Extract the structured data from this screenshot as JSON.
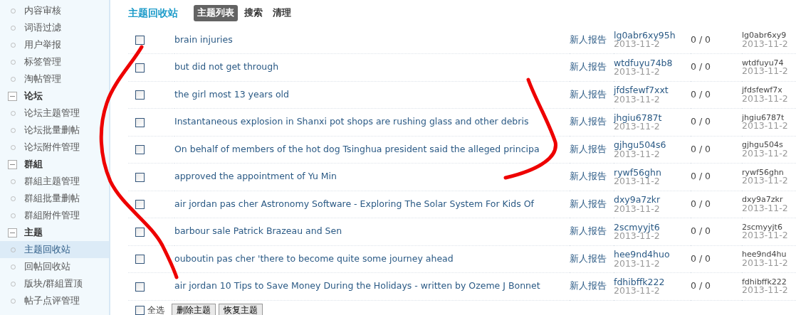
{
  "sidebar": {
    "sections": [
      {
        "items": [
          {
            "label": "内容审核",
            "selected": false
          },
          {
            "label": "词语过滤",
            "selected": false
          },
          {
            "label": "用户举报",
            "selected": false
          },
          {
            "label": "标签管理",
            "selected": false
          },
          {
            "label": "淘帖管理",
            "selected": false
          }
        ]
      },
      {
        "title": "论坛",
        "expanded": true,
        "items": [
          {
            "label": "论坛主题管理",
            "selected": false
          },
          {
            "label": "论坛批量删帖",
            "selected": false
          },
          {
            "label": "论坛附件管理",
            "selected": false
          }
        ]
      },
      {
        "title": "群組",
        "expanded": true,
        "items": [
          {
            "label": "群組主题管理",
            "selected": false
          },
          {
            "label": "群組批量删帖",
            "selected": false
          },
          {
            "label": "群組附件管理",
            "selected": false
          }
        ]
      },
      {
        "title": "主题",
        "expanded": true,
        "items": [
          {
            "label": "主题回收站",
            "selected": true
          },
          {
            "label": "回帖回收站",
            "selected": false
          },
          {
            "label": "版块/群組置顶",
            "selected": false
          },
          {
            "label": "帖子点评管理",
            "selected": false
          }
        ]
      }
    ]
  },
  "header": {
    "title": "主题回收站",
    "tabs": [
      {
        "label": "主题列表",
        "selected": true
      },
      {
        "label": "搜索",
        "selected": false
      },
      {
        "label": "清理",
        "selected": false
      }
    ]
  },
  "table": {
    "rows": [
      {
        "checked": false,
        "subject": "brain injuries",
        "forum": "新人报告",
        "author": "lg0abr6xy95h",
        "date": "2013-11-2",
        "replies": "0 / 0",
        "last_author": "lg0abr6xy9",
        "last_date": "2013-11-2"
      },
      {
        "checked": false,
        "subject": "but did not get through",
        "forum": "新人报告",
        "author": "wtdfuyu74b8",
        "date": "2013-11-2",
        "replies": "0 / 0",
        "last_author": "wtdfuyu74",
        "last_date": "2013-11-2"
      },
      {
        "checked": false,
        "subject": "the girl most 13 years old",
        "forum": "新人报告",
        "author": "jfdsfewf7xxt",
        "date": "2013-11-2",
        "replies": "0 / 0",
        "last_author": "jfdsfewf7x",
        "last_date": "2013-11-2"
      },
      {
        "checked": false,
        "subject": "Instantaneous explosion in Shanxi pot shops are rushing glass and other debris",
        "forum": "新人报告",
        "author": "jhgiu6787t",
        "date": "2013-11-2",
        "replies": "0 / 0",
        "last_author": "jhgiu6787t",
        "last_date": "2013-11-2"
      },
      {
        "checked": false,
        "subject": "On behalf of members of the hot dog Tsinghua president said the alleged principa",
        "forum": "新人报告",
        "author": "gjhgu504s6",
        "date": "2013-11-2",
        "replies": "0 / 0",
        "last_author": "gjhgu504s",
        "last_date": "2013-11-2"
      },
      {
        "checked": false,
        "subject": "approved the appointment of Yu Min",
        "forum": "新人报告",
        "author": "rywf56ghn",
        "date": "2013-11-2",
        "replies": "0 / 0",
        "last_author": "rywf56ghn",
        "last_date": "2013-11-2"
      },
      {
        "checked": false,
        "subject": "air jordan pas cher Astronomy Software - Exploring The Solar System For Kids Of",
        "forum": "新人报告",
        "author": "dxy9a7zkr",
        "date": "2013-11-2",
        "replies": "0 / 0",
        "last_author": "dxy9a7zkr",
        "last_date": "2013-11-2"
      },
      {
        "checked": false,
        "subject": "barbour sale Patrick Brazeau and Sen",
        "forum": "新人报告",
        "author": "2scmyyjt6",
        "date": "2013-11-2",
        "replies": "0 / 0",
        "last_author": "2scmyyjt6",
        "last_date": "2013-11-2"
      },
      {
        "checked": false,
        "subject": "ouboutin pas cher 'there to become quite some journey ahead",
        "forum": "新人报告",
        "author": "hee9nd4huo",
        "date": "2013-11-2",
        "replies": "0 / 0",
        "last_author": "hee9nd4hu",
        "last_date": "2013-11-2"
      },
      {
        "checked": false,
        "subject": "air jordan 10 Tips to Save Money During the Holidays - written by Ozeme J Bonnet",
        "forum": "新人报告",
        "author": "fdhibffk222",
        "date": "2013-11-2",
        "replies": "0 / 0",
        "last_author": "fdhibffk222",
        "last_date": "2013-11-2"
      }
    ]
  },
  "footer": {
    "select_all": {
      "label": "全选",
      "checked": false
    },
    "buttons": [
      "删除主题",
      "恢复主题"
    ]
  }
}
